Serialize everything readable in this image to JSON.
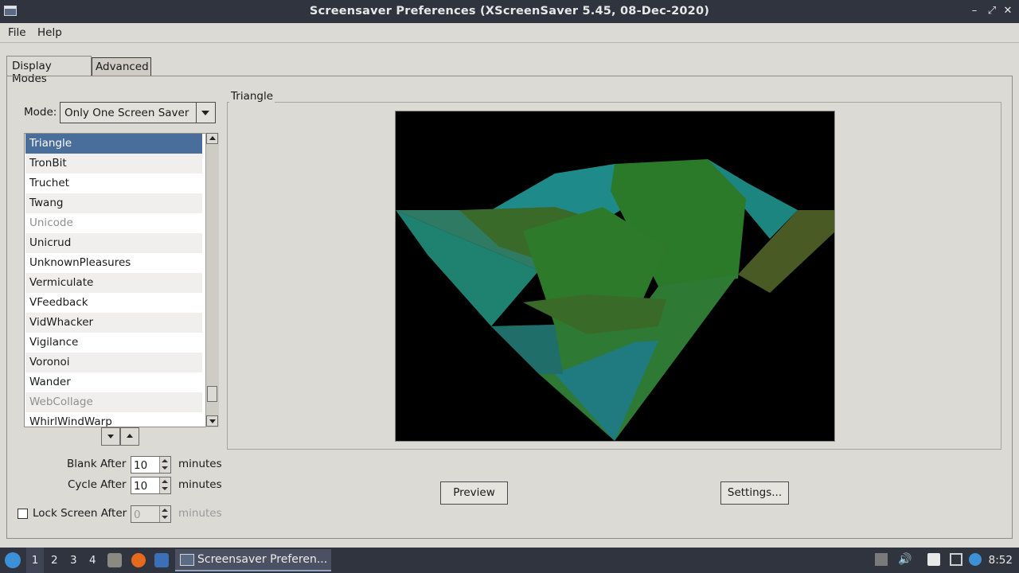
{
  "window": {
    "title": "Screensaver Preferences  (XScreenSaver 5.45, 08-Dec-2020)",
    "minimize": "–",
    "maximize": "⤢",
    "close": "✕"
  },
  "menu": {
    "file": "File",
    "help": "Help"
  },
  "tabs": [
    {
      "label": "Display Modes"
    },
    {
      "label": "Advanced"
    }
  ],
  "mode": {
    "label": "Mode:",
    "value": "Only One Screen Saver"
  },
  "savers": [
    {
      "label": "Triangle",
      "selected": true
    },
    {
      "label": "TronBit"
    },
    {
      "label": "Truchet"
    },
    {
      "label": "Twang"
    },
    {
      "label": "Unicode",
      "disabled": true
    },
    {
      "label": "Unicrud"
    },
    {
      "label": "UnknownPleasures"
    },
    {
      "label": "Vermiculate"
    },
    {
      "label": "VFeedback"
    },
    {
      "label": "VidWhacker"
    },
    {
      "label": "Vigilance"
    },
    {
      "label": "Voronoi"
    },
    {
      "label": "Wander"
    },
    {
      "label": "WebCollage",
      "disabled": true
    },
    {
      "label": "WhirlWindWarp"
    }
  ],
  "timing": {
    "blank_label": "Blank After",
    "blank_value": "10",
    "cycle_label": "Cycle After",
    "cycle_value": "10",
    "lock_label": "Lock Screen After",
    "lock_value": "0",
    "minutes": "minutes"
  },
  "preview_frame": {
    "label": "Triangle"
  },
  "buttons": {
    "preview": "Preview",
    "settings": "Settings..."
  },
  "taskbar": {
    "workspaces": [
      "1",
      "2",
      "3",
      "4"
    ],
    "task_title": "Screensaver Preferen...",
    "clock": "8:52"
  },
  "colors": {
    "selection": "#4a6e9c",
    "titlebar": "#2f343f",
    "window_bg": "#dcdad5"
  }
}
